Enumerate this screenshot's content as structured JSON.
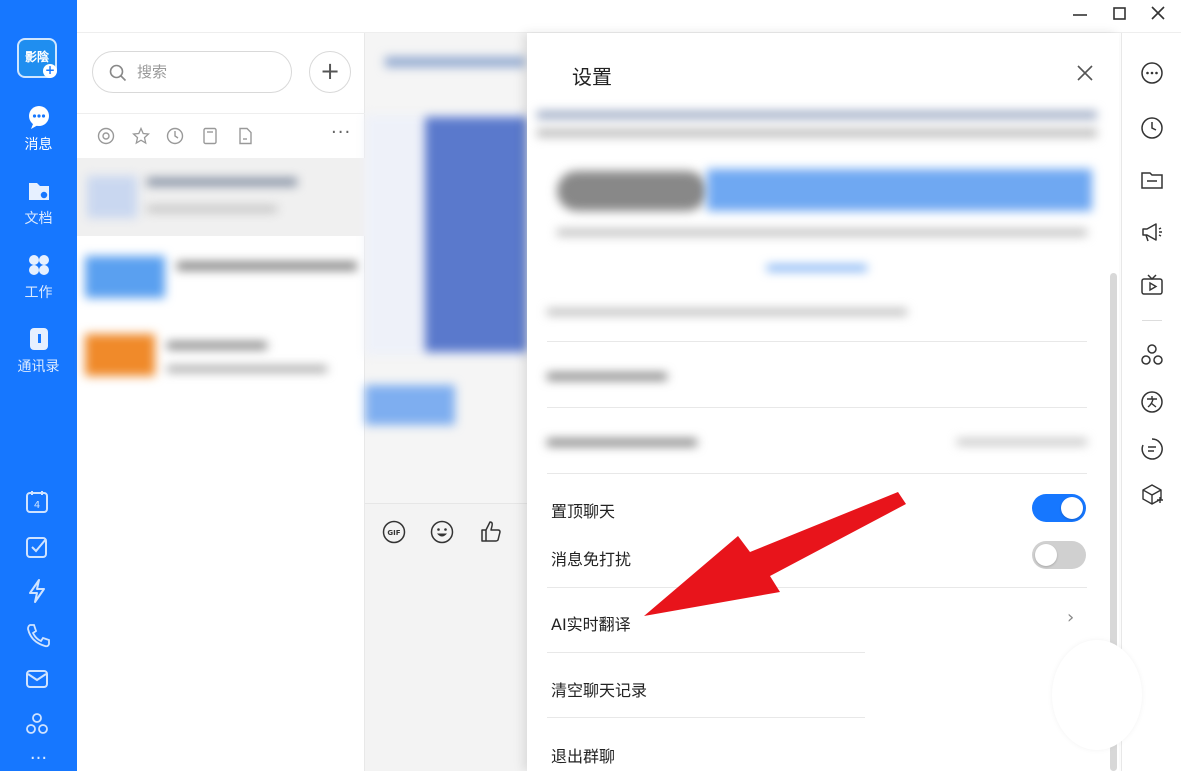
{
  "nav": {
    "logo_text": "影陰",
    "items": [
      {
        "label": "消息",
        "icon": "chat-bubble-icon"
      },
      {
        "label": "文档",
        "icon": "folder-icon"
      },
      {
        "label": "工作",
        "icon": "grid-icon"
      },
      {
        "label": "通讯录",
        "icon": "contacts-icon"
      }
    ],
    "bottom_icons": [
      "calendar-icon",
      "todo-check-icon",
      "lightning-icon",
      "phone-icon",
      "mail-icon",
      "apps-icon",
      "more-icon"
    ],
    "calendar_day": "4"
  },
  "list": {
    "search_placeholder": "搜索",
    "add_label": "+",
    "filter_icons": [
      "mention-icon",
      "star-icon",
      "clock-icon",
      "bookmark-icon",
      "file-icon"
    ],
    "more_label": "···"
  },
  "chat": {
    "toolbar_icons": [
      "gif-icon",
      "emoji-icon",
      "thumbs-up-icon"
    ],
    "gif_label": "GIF"
  },
  "window": {
    "minimize": "—",
    "maximize": "□",
    "close": "✕"
  },
  "settings": {
    "title": "设置",
    "close_label": "×",
    "pin_chat": "置顶聊天",
    "pin_chat_on": true,
    "mute": "消息免打扰",
    "mute_on": false,
    "ai_translate": "AI实时翻译",
    "clear_history": "清空聊天记录",
    "leave_group": "退出群聊",
    "chevron": "›"
  },
  "rail": {
    "icons": [
      "more-circle-icon",
      "history-icon",
      "folder-icon",
      "megaphone-icon",
      "tv-icon",
      "apps-cluster-icon",
      "translate-icon",
      "ai-assist-icon",
      "cube-add-icon"
    ]
  },
  "colors": {
    "accent": "#1677ff",
    "toggle_off": "#d0d0d0",
    "annotation_arrow": "#e8141b"
  }
}
